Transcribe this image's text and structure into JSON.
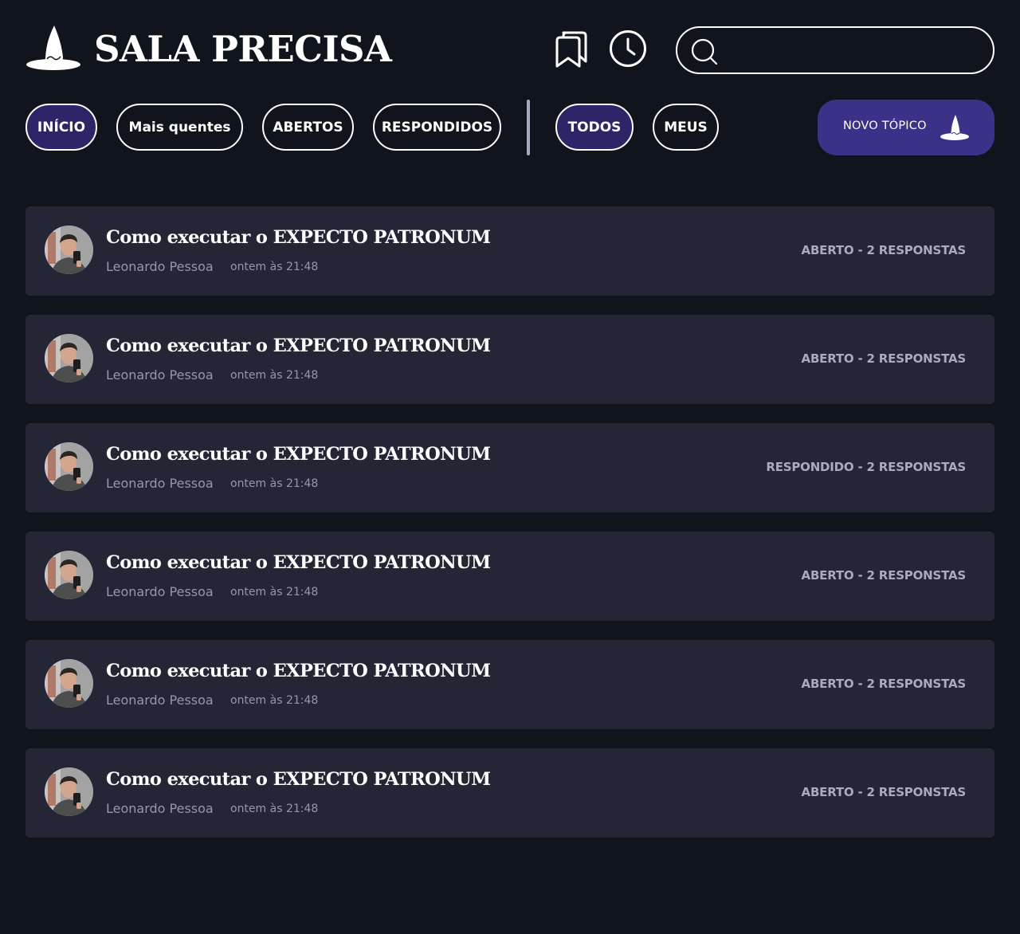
{
  "header": {
    "brand": "SALA PRECISA",
    "logo_icon": "wizard-hat-icon",
    "bookmarks_icon": "bookmarks-icon",
    "history_icon": "clock-icon",
    "search": {
      "icon": "search-icon",
      "value": "",
      "placeholder": ""
    }
  },
  "filters": {
    "primary": [
      {
        "label": "INÍCIO",
        "active": true
      },
      {
        "label": "Mais quentes",
        "active": false
      },
      {
        "label": "ABERTOS",
        "active": false
      },
      {
        "label": "RESPONDIDOS",
        "active": false
      }
    ],
    "scope": [
      {
        "label": "TODOS",
        "active": true
      },
      {
        "label": "MEUS",
        "active": false
      }
    ],
    "new_topic": {
      "label": "NOVO TÓPICO",
      "icon": "wizard-hat-icon"
    }
  },
  "topics": [
    {
      "title": "Como executar o EXPECTO PATRONUM",
      "author": "Leonardo Pessoa",
      "date": "ontem às 21:48",
      "status": "ABERTO - 2 RESPONSTAS"
    },
    {
      "title": "Como executar o EXPECTO PATRONUM",
      "author": "Leonardo Pessoa",
      "date": "ontem às 21:48",
      "status": "ABERTO - 2 RESPONSTAS"
    },
    {
      "title": "Como executar o EXPECTO PATRONUM",
      "author": "Leonardo Pessoa",
      "date": "ontem às 21:48",
      "status": "RESPONDIDO - 2 RESPONSTAS"
    },
    {
      "title": "Como executar o EXPECTO PATRONUM",
      "author": "Leonardo Pessoa",
      "date": "ontem às 21:48",
      "status": "ABERTO - 2 RESPONSTAS"
    },
    {
      "title": "Como executar o EXPECTO PATRONUM",
      "author": "Leonardo Pessoa",
      "date": "ontem às 21:48",
      "status": "ABERTO - 2 RESPONSTAS"
    },
    {
      "title": "Como executar o EXPECTO PATRONUM",
      "author": "Leonardo Pessoa",
      "date": "ontem às 21:48",
      "status": "ABERTO - 2 RESPONSTAS"
    }
  ],
  "colors": {
    "background": "#10141d",
    "card": "#242636",
    "accent": "#3a3188",
    "active_pill": "#2e2468",
    "muted_text": "#9698aa"
  }
}
